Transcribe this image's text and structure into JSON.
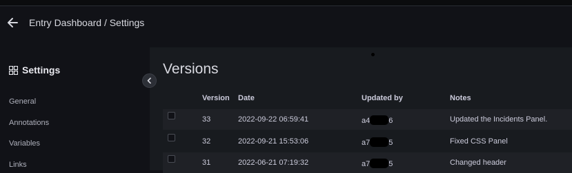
{
  "header": {
    "breadcrumb": "Entry Dashboard / Settings"
  },
  "sidebar": {
    "title": "Settings",
    "items": [
      {
        "label": "General"
      },
      {
        "label": "Annotations"
      },
      {
        "label": "Variables"
      },
      {
        "label": "Links"
      }
    ]
  },
  "main": {
    "title": "Versions",
    "columns": {
      "version": "Version",
      "date": "Date",
      "updated_by": "Updated by",
      "notes": "Notes"
    },
    "rows": [
      {
        "version": "33",
        "date": "2022-09-22 06:59:41",
        "user_start": "a4",
        "user_end": "6",
        "notes": "Updated the Incidents Panel."
      },
      {
        "version": "32",
        "date": "2022-09-21 15:53:06",
        "user_start": "a7",
        "user_end": "5",
        "notes": "Fixed CSS Panel"
      },
      {
        "version": "31",
        "date": "2022-06-21 07:19:32",
        "user_start": "a7",
        "user_end": "5",
        "notes": "Changed header"
      }
    ]
  },
  "icons": {
    "back": "arrow-left-icon",
    "settings": "apps-grid-icon",
    "collapse": "chevron-left-icon"
  },
  "colors": {
    "background": "#111217",
    "panel": "#181b1f",
    "text": "#ccccdc"
  }
}
